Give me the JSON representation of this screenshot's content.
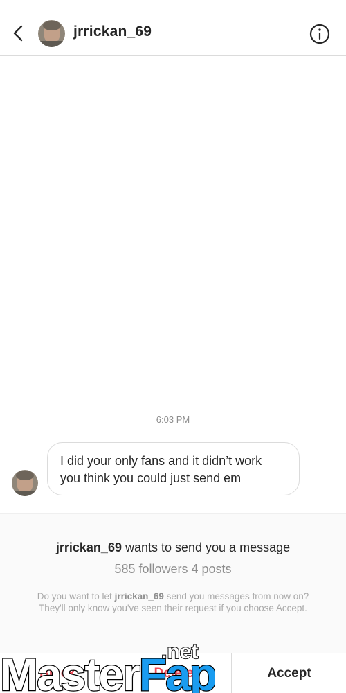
{
  "header": {
    "username": "jrrickan_69",
    "back_icon": "chevron-left-icon",
    "info_icon": "info-circle-icon"
  },
  "thread": {
    "timestamp": "6:03 PM",
    "message_line1": "I did your only fans and it didn’t work",
    "message_line2": "you think you could just send em"
  },
  "request": {
    "title_username": "jrrickan_69",
    "title_suffix": " wants to send you a message",
    "stats": "585 followers 4 posts",
    "desc_prefix": "Do you want to let ",
    "desc_username": "jrrickan_69",
    "desc_suffix": " send you messages from now on? They'll only know you've seen their request if you choose Accept."
  },
  "actions": {
    "block_label": "Block",
    "delete_label": "Delete",
    "accept_label": "Accept"
  },
  "watermark": {
    "text_main": "MasterFap",
    "text_tld": ".net"
  },
  "colors": {
    "accent_red": "#ed4956",
    "watermark_blue": "#1a9cf0",
    "text_primary": "#262626",
    "text_secondary": "#8e8e8e",
    "divider": "#dbdbdb"
  }
}
